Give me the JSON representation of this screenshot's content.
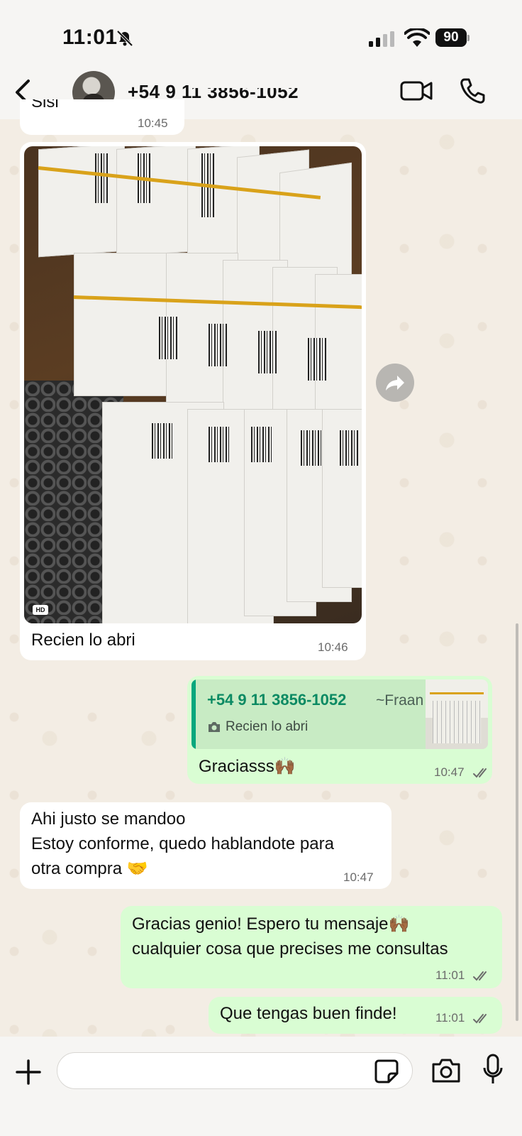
{
  "status_bar": {
    "time": "11:01",
    "battery": "90"
  },
  "header": {
    "contact": "+54 9 11 3856-1052"
  },
  "messages": [
    {
      "id": "m0",
      "direction": "in",
      "text": "Sisi",
      "time": "10:45"
    },
    {
      "id": "m1",
      "direction": "in",
      "type": "photo",
      "caption": "Recien lo abri",
      "time": "10:46",
      "badge": "HD"
    },
    {
      "id": "m2",
      "direction": "out",
      "text": "Graciasss🙌🏾",
      "time": "10:47",
      "status": "read",
      "reply": {
        "author": "+54 9 11 3856-1052",
        "alias": "~Fraan",
        "text": "Recien lo abri"
      }
    },
    {
      "id": "m3",
      "direction": "in",
      "text": "Ahi justo se mandoo\nEstoy conforme, quedo hablandote para\notra compra 🤝",
      "time": "10:47"
    },
    {
      "id": "m4",
      "direction": "out",
      "text": "Gracias genio! Espero tu mensaje🙌🏾\ncualquier cosa que precises me consultas",
      "time": "11:01",
      "status": "read"
    },
    {
      "id": "m5",
      "direction": "out",
      "text": "Que tengas buen finde!",
      "time": "11:01",
      "status": "read"
    }
  ],
  "composer": {
    "placeholder": ""
  },
  "colors": {
    "incoming": "#ffffff",
    "outgoing": "#d9fdd3",
    "accent": "#0b8a63",
    "background": "#f3ede4"
  },
  "icons": [
    "bell-slash-icon",
    "signal-icon",
    "wifi-icon",
    "battery-icon",
    "back-chevron-icon",
    "video-call-icon",
    "phone-icon",
    "forward-icon",
    "camera-small-icon",
    "read-ticks-icon",
    "plus-icon",
    "sticker-icon",
    "camera-icon",
    "microphone-icon"
  ]
}
